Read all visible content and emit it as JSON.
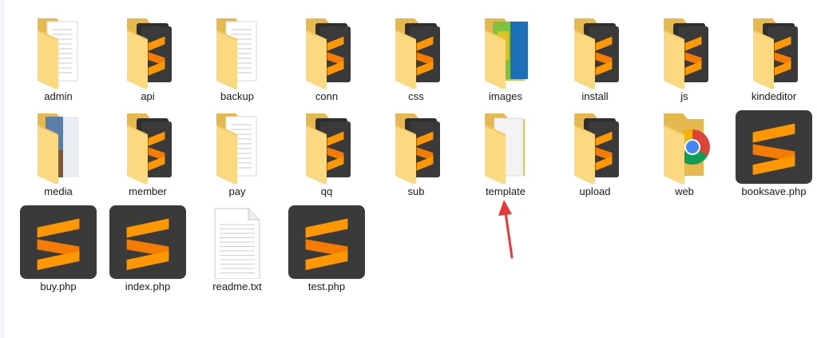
{
  "colors": {
    "folder_back": "#e6b94f",
    "folder_front": "#fad981",
    "sublime_bg": "#3a3a3a",
    "sublime_orange": "#ff9800",
    "annotation_arrow": "#e8393a"
  },
  "items": [
    {
      "label": "admin",
      "icon": "folder-document-icon"
    },
    {
      "label": "api",
      "icon": "folder-sublime-icon"
    },
    {
      "label": "backup",
      "icon": "folder-document-icon"
    },
    {
      "label": "conn",
      "icon": "folder-sublime-icon"
    },
    {
      "label": "css",
      "icon": "folder-sublime-icon"
    },
    {
      "label": "images",
      "icon": "folder-image-icon"
    },
    {
      "label": "install",
      "icon": "folder-sublime-icon"
    },
    {
      "label": "js",
      "icon": "folder-sublime-icon"
    },
    {
      "label": "kindeditor",
      "icon": "folder-sublime-icon"
    },
    {
      "label": "media",
      "icon": "folder-photo-icon"
    },
    {
      "label": "member",
      "icon": "folder-sublime-icon"
    },
    {
      "label": "pay",
      "icon": "folder-document-icon"
    },
    {
      "label": "qq",
      "icon": "folder-sublime-icon"
    },
    {
      "label": "sub",
      "icon": "folder-sublime-icon"
    },
    {
      "label": "template",
      "icon": "folder-plain-icon"
    },
    {
      "label": "upload",
      "icon": "folder-sublime-icon"
    },
    {
      "label": "web",
      "icon": "folder-chrome-icon"
    },
    {
      "label": "booksave.php",
      "icon": "sublime-file-icon"
    },
    {
      "label": "buy.php",
      "icon": "sublime-file-icon"
    },
    {
      "label": "index.php",
      "icon": "sublime-file-icon"
    },
    {
      "label": "readme.txt",
      "icon": "text-file-icon"
    },
    {
      "label": "test.php",
      "icon": "sublime-file-icon"
    }
  ]
}
